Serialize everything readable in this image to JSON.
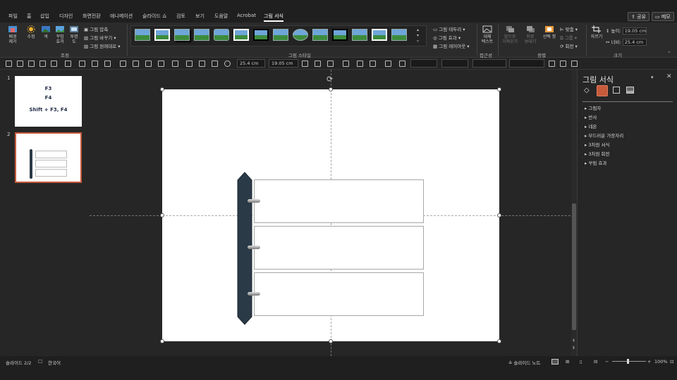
{
  "tabs": [
    "파일",
    "홈",
    "삽입",
    "디자인",
    "화면전환",
    "애니메이션",
    "슬라이드 쇼",
    "검토",
    "보기",
    "도움말",
    "Acrobat",
    "그림 서식"
  ],
  "active_tab": "그림 서식",
  "top_buttons": {
    "share": "공유",
    "comments": "메모"
  },
  "ribbon": {
    "remove_bg": "배경\n제거",
    "corrections": "수정",
    "color": "색",
    "artistic": "꾸밈\n효과",
    "transparency": "투명\n도",
    "compress": "그림 압축",
    "change": "그림 바꾸기",
    "reset": "그림 원래대로",
    "group_adjust": "조정",
    "group_styles": "그림 스타일",
    "border": "그림 테두리",
    "effects": "그림 효과",
    "layout": "그림 레이아웃",
    "alt_text": "대체\n텍스트",
    "group_access": "접근성",
    "bring_forward": "앞으로\n가져오기",
    "send_backward": "뒤로\n보내기",
    "selection_pane": "선택 창",
    "align": "맞춤",
    "group": "그룹",
    "rotate": "회전",
    "group_arrange": "정렬",
    "crop": "자르기",
    "height_label": "높이:",
    "height_value": "19.05 cm",
    "width_label": "너비:",
    "width_value": "25.4 cm",
    "group_size": "크기"
  },
  "toolbar": {
    "field1": "25.4 cm",
    "field2": "19.05 cm"
  },
  "slides": [
    {
      "number": "1",
      "lines": [
        "F3",
        "F4",
        "Shift + F3, F4"
      ]
    },
    {
      "number": "2"
    }
  ],
  "format_pane": {
    "title": "그림 서식",
    "items": [
      "그림자",
      "반사",
      "네온",
      "부드러운 가장자리",
      "3차원 서식",
      "3차원 회전",
      "꾸밈 효과"
    ]
  },
  "status": {
    "slide_info": "슬라이드 2/2",
    "language": "한국어",
    "notes": "슬라이드 노트",
    "zoom": "100%"
  },
  "colors": {
    "binder": "#2a3a47",
    "accent": "#c55a3c"
  }
}
